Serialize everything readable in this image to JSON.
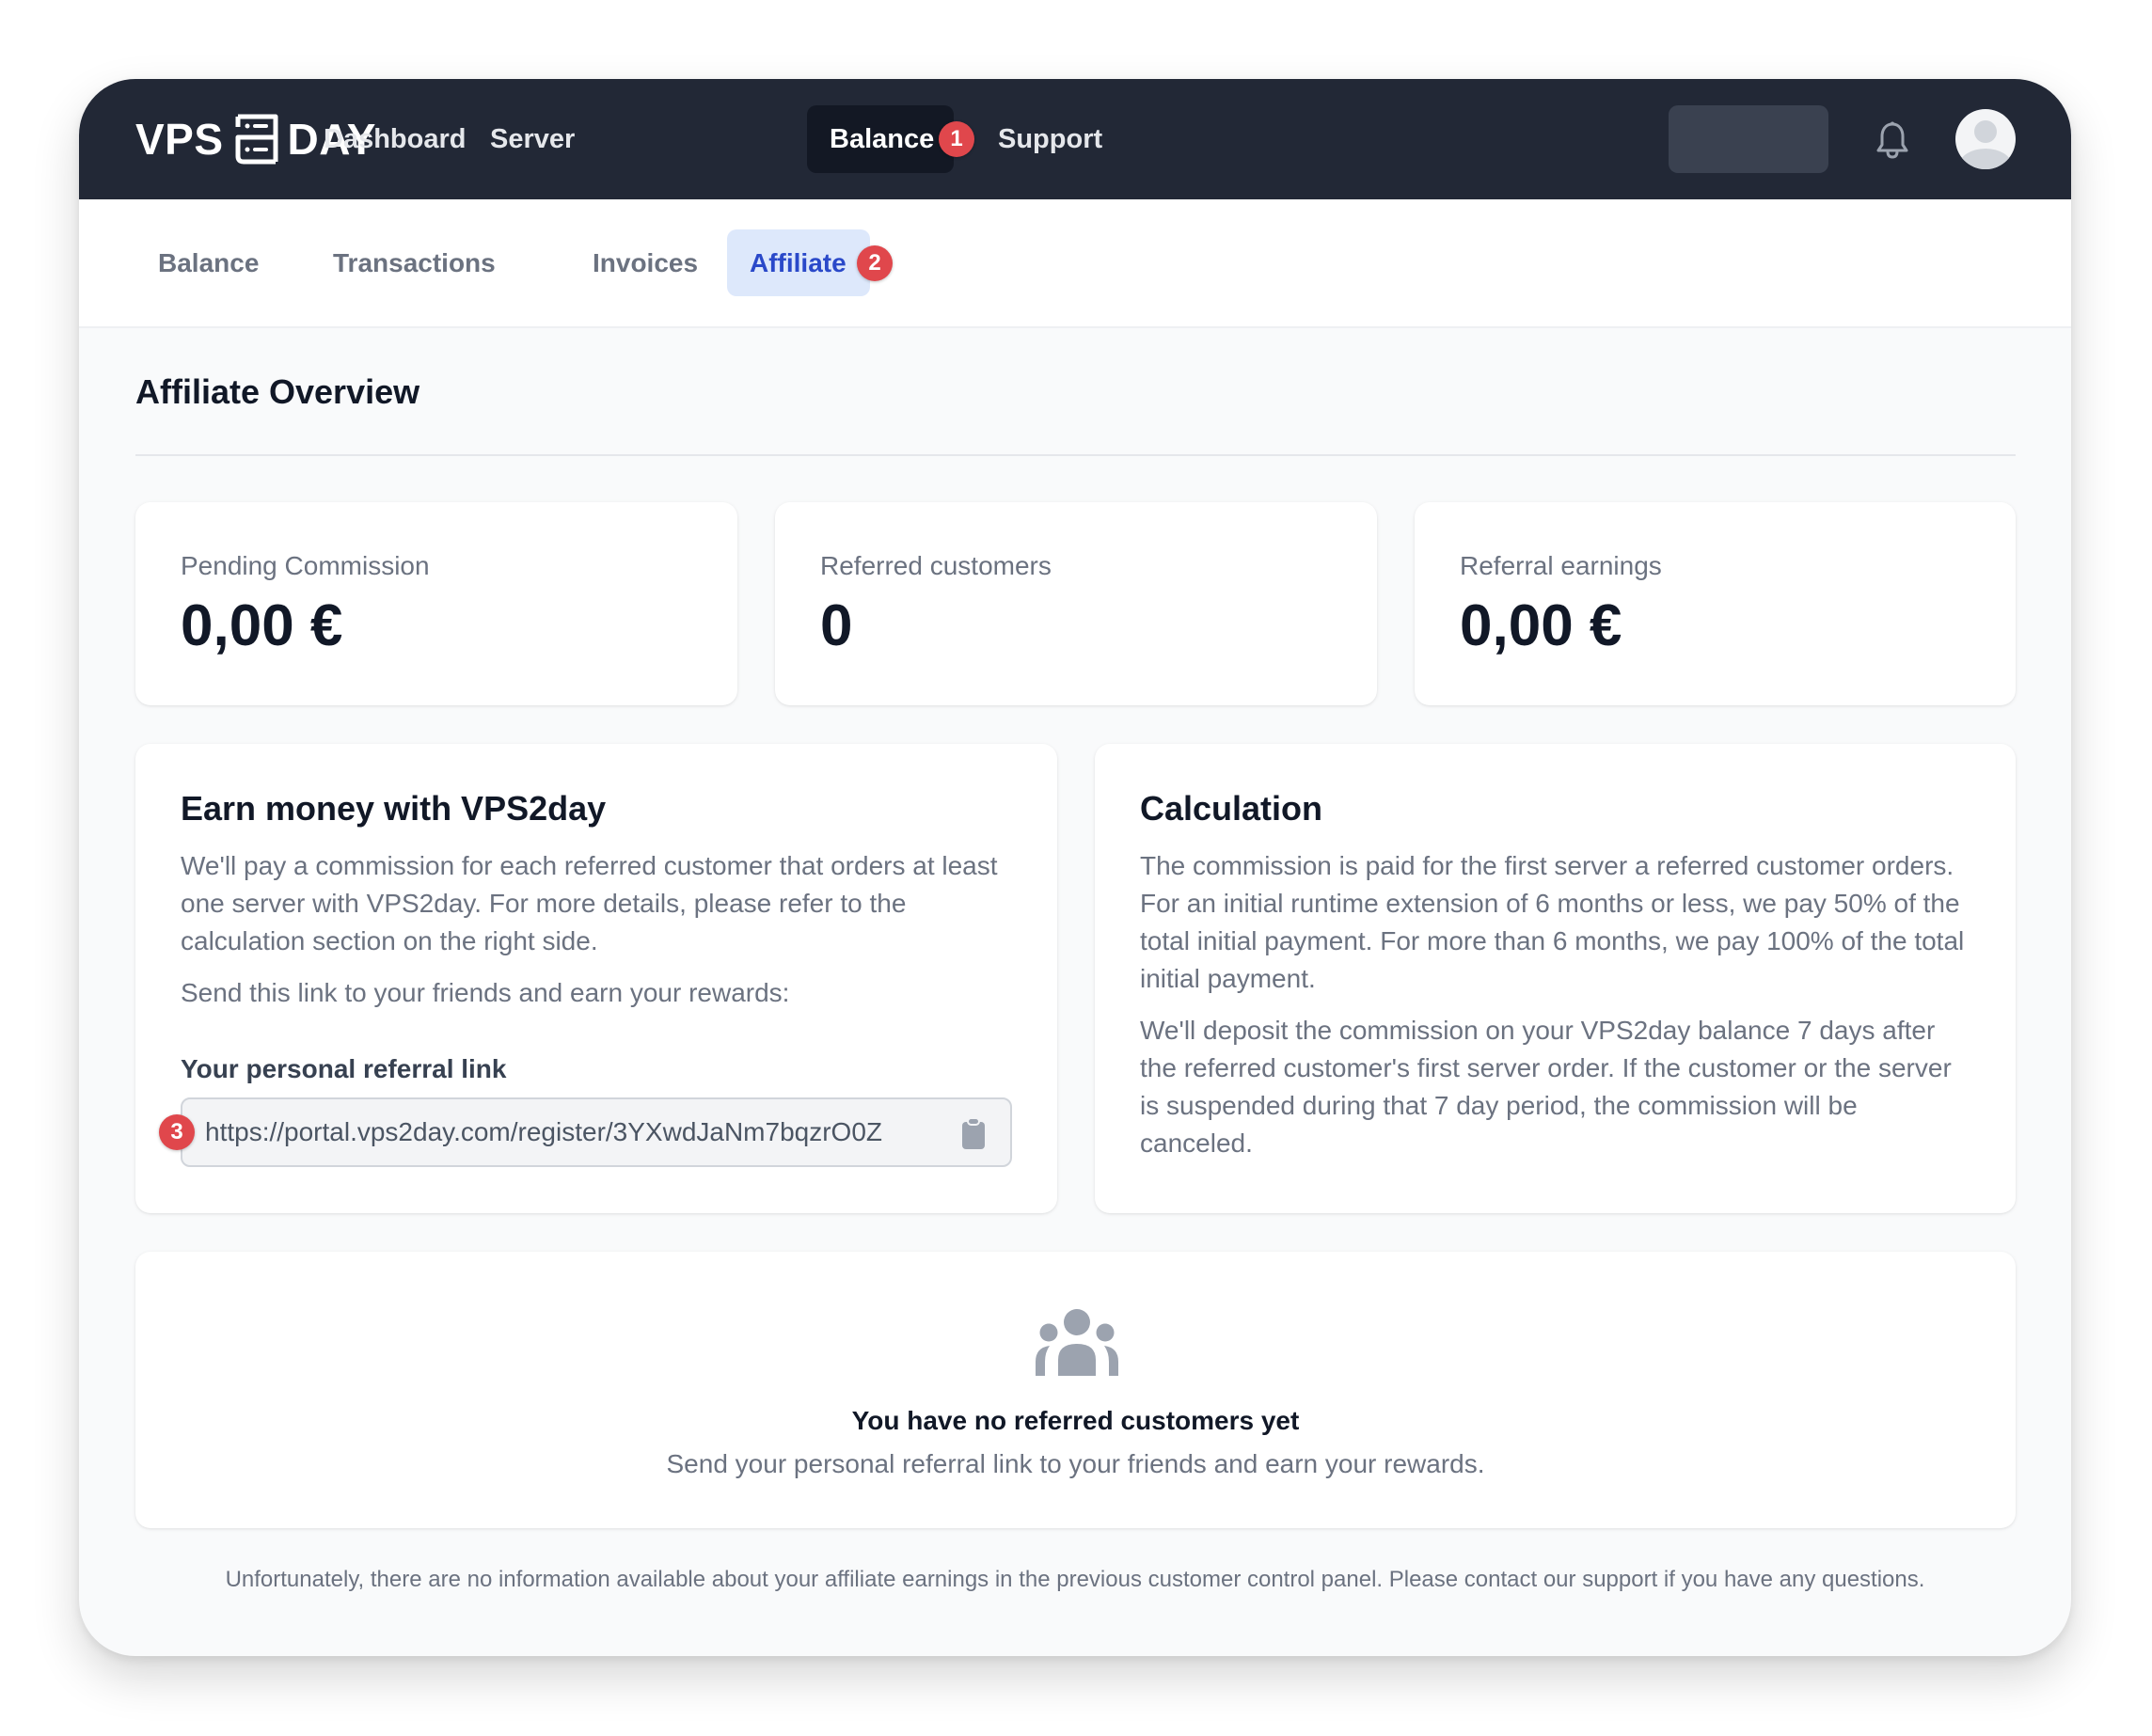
{
  "brand": {
    "name_left": "VPS",
    "name_right": "DAY"
  },
  "topnav": {
    "items": [
      {
        "label": "Dashboard",
        "active": false
      },
      {
        "label": "Server",
        "active": false
      },
      {
        "label": "Balance",
        "active": true,
        "badge": "1"
      },
      {
        "label": "Support",
        "active": false
      }
    ]
  },
  "subnav": {
    "tabs": [
      {
        "label": "Balance",
        "active": false
      },
      {
        "label": "Transactions",
        "active": false
      },
      {
        "label": "Invoices",
        "active": false
      },
      {
        "label": "Affiliate",
        "active": true,
        "badge": "2"
      }
    ]
  },
  "page": {
    "title": "Affiliate Overview"
  },
  "stats": [
    {
      "label": "Pending Commission",
      "value": "0,00 €"
    },
    {
      "label": "Referred customers",
      "value": "0"
    },
    {
      "label": "Referral earnings",
      "value": "0,00 €"
    }
  ],
  "earn": {
    "title": "Earn money with VPS2day",
    "paragraph1": "We'll pay a commission for each referred customer that orders at least one server with VPS2day. For more details, please refer to the calculation section on the right side.",
    "paragraph2": "Send this link to your friends and earn your rewards:",
    "link_label": "Your personal referral link",
    "link_value": "https://portal.vps2day.com/register/3YXwdJaNm7bqzrO0Z",
    "link_badge": "3"
  },
  "calculation": {
    "title": "Calculation",
    "paragraph1": "The commission is paid for the first server a referred customer orders. For an initial runtime extension of 6 months or less, we pay 50% of the total initial payment. For more than 6 months, we pay 100% of the total initial payment.",
    "paragraph2": "We'll deposit the commission on your VPS2day balance 7 days after the referred customer's first server order. If the customer or the server is suspended during that 7 day period, the commission will be canceled."
  },
  "empty_state": {
    "icon": "users-icon",
    "title": "You have no referred customers yet",
    "subtitle": "Send your personal referral link to your friends and earn your rewards."
  },
  "footer_note": "Unfortunately, there are no information available about your affiliate earnings in the previous customer control panel. Please contact our support if you have any questions.",
  "colors": {
    "nav_bg": "#222836",
    "active_nav_bg": "#131824",
    "badge": "#e0474c",
    "active_tab_bg": "#dde8fb",
    "active_tab_text": "#2a49c9",
    "page_bg": "#f9fafb"
  }
}
